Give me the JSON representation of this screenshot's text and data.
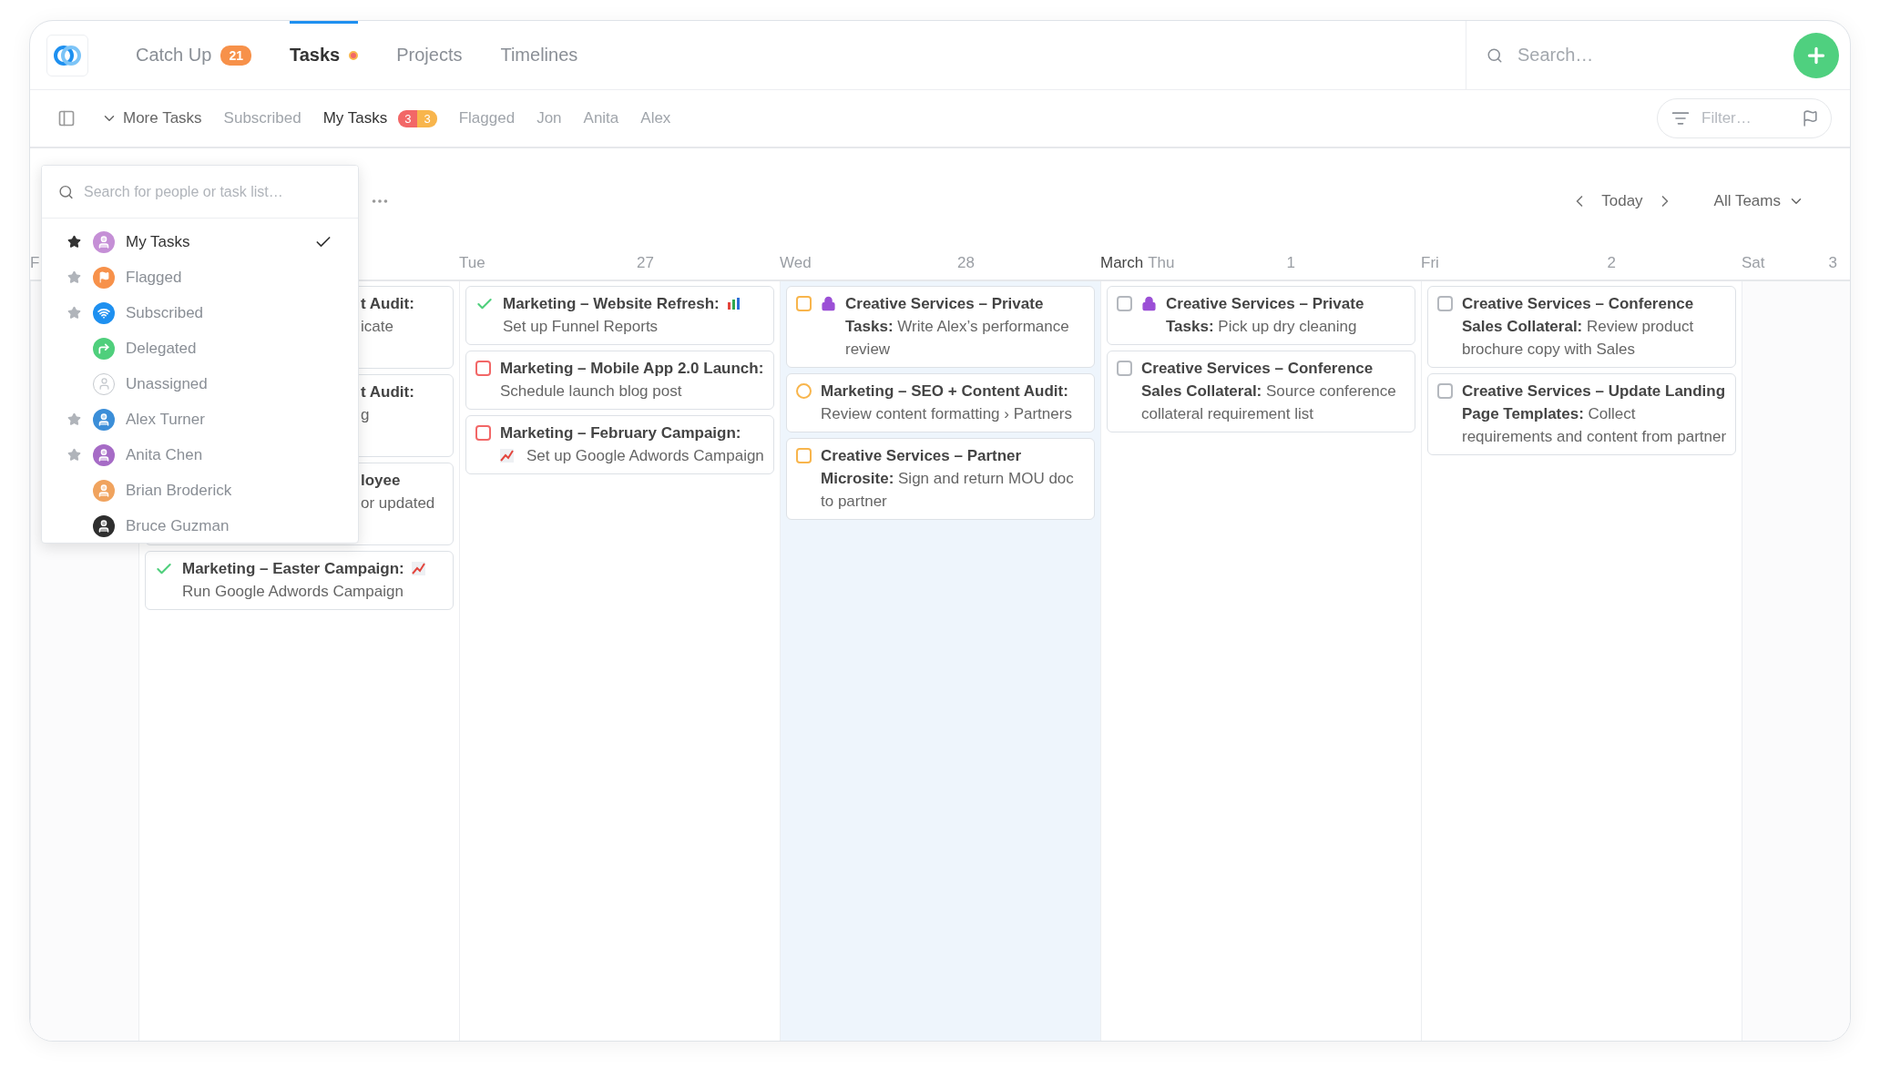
{
  "topbar": {
    "tabs": [
      {
        "label": "Catch Up",
        "badge": "21",
        "dot": false,
        "selected": false
      },
      {
        "label": "Tasks",
        "dot": true,
        "selected": true
      },
      {
        "label": "Projects",
        "dot": false,
        "selected": false
      },
      {
        "label": "Timelines",
        "dot": false,
        "selected": false
      }
    ],
    "search": {
      "placeholder": "Search…"
    }
  },
  "subnav": {
    "items": [
      {
        "label": "More Tasks",
        "kind": "menu",
        "selected": false
      },
      {
        "label": "Subscribed",
        "kind": "link",
        "selected": false
      },
      {
        "label": "My Tasks",
        "kind": "link",
        "selected": true,
        "badges": [
          {
            "text": "3",
            "color": "#f26767"
          },
          {
            "text": "3",
            "color": "#f8b54c"
          }
        ]
      },
      {
        "label": "Flagged",
        "kind": "link",
        "selected": false
      },
      {
        "label": "Jon",
        "kind": "link",
        "selected": false
      },
      {
        "label": "Anita",
        "kind": "link",
        "selected": false
      },
      {
        "label": "Alex",
        "kind": "link",
        "selected": false
      }
    ],
    "filter": {
      "placeholder": "Filter…"
    }
  },
  "calendar": {
    "nav": {
      "today": "Today",
      "team": "All Teams"
    },
    "columns": [
      {
        "kind": "narrow",
        "day": "F"
      },
      {
        "kind": "wide",
        "today": false,
        "cards": [
          {
            "title": "t Audit:",
            "body": "icate",
            "kind": "clipped"
          },
          {
            "title": "t Audit:",
            "body": "g",
            "kind": "clipped"
          },
          {
            "title": "loyee",
            "body": "or updated",
            "kind": "clipped"
          },
          {
            "title": "Marketing – Easter Campaign:",
            "title_icon": {
              "kind": "trend"
            },
            "body": "Run Google Adwords Campaign",
            "kind": "done"
          }
        ]
      },
      {
        "kind": "wide",
        "day": "Tue",
        "date": "27",
        "today": false,
        "cards": [
          {
            "title": "Marketing – Website Refresh:",
            "title_icon": {
              "kind": "bars"
            },
            "body": "Set up Funnel Reports",
            "kind": "done"
          },
          {
            "title": "Marketing – Mobile App 2.0 Launch:",
            "body": "Schedule launch blog post",
            "kind": "square",
            "color": "#f26767"
          },
          {
            "title": "Marketing – February Campaign:",
            "body_icon": {
              "kind": "trend"
            },
            "body": "Set up Google Adwords Campaign",
            "kind": "square",
            "color": "#f26767"
          }
        ]
      },
      {
        "kind": "wide",
        "day": "Wed",
        "date": "28",
        "today": true,
        "cards": [
          {
            "title": "Creative Services – Private Tasks:",
            "body": "Write Alex’s performance review",
            "kind": "square",
            "color": "#f8b54c",
            "private": true
          },
          {
            "title": "Marketing – SEO + Content Audit:",
            "body": "Review content formatting › Partners",
            "kind": "round",
            "color": "#f8b54c"
          },
          {
            "title": "Creative Services – Partner Microsite:",
            "body": "Sign and return MOU doc to partner",
            "kind": "square",
            "color": "#f8b54c"
          }
        ]
      },
      {
        "kind": "wide",
        "month": "March",
        "day": "Thu",
        "date": "1",
        "today": false,
        "cards": [
          {
            "title": "Creative Services – Private Tasks:",
            "body": "Pick up dry cleaning",
            "kind": "square",
            "color": "#b4b8be",
            "private": true
          },
          {
            "title": "Creative Services – Conference Sales Collateral:",
            "body": "Source conference collateral requirement list",
            "kind": "square",
            "color": "#b4b8be"
          }
        ]
      },
      {
        "kind": "wide",
        "day": "Fri",
        "date": "2",
        "today": false,
        "cards": [
          {
            "title": "Creative Services – Conference Sales Collateral:",
            "body": "Review product brochure copy with Sales",
            "kind": "square",
            "color": "#b4b8be"
          },
          {
            "title": "Creative Services – Update Landing Page Templates:",
            "body": "Collect requirements and content from partner",
            "kind": "square",
            "color": "#b4b8be"
          }
        ]
      },
      {
        "kind": "narrow",
        "day": "Sat",
        "date": "3"
      }
    ]
  },
  "dropdown": {
    "placeholder": "Search for people or task list…",
    "items": [
      {
        "label": "My Tasks",
        "kind": "person",
        "color": "#c58fd6",
        "starred": true,
        "selected": true
      },
      {
        "label": "Flagged",
        "kind": "flag",
        "color": "#f7914a",
        "starred": true,
        "selected": false
      },
      {
        "label": "Subscribed",
        "kind": "feed",
        "color": "#1e90f0",
        "starred": true,
        "selected": false
      },
      {
        "label": "Delegated",
        "kind": "delegate",
        "color": "#4fcf7c",
        "starred": false,
        "selected": false
      },
      {
        "label": "Unassigned",
        "kind": "unassigned",
        "starred": false,
        "selected": false
      },
      {
        "label": "Alex Turner",
        "kind": "person",
        "color": "#3b8ed8",
        "starred": true,
        "selected": false
      },
      {
        "label": "Anita Chen",
        "kind": "person",
        "color": "#a66bc6",
        "starred": true,
        "selected": false
      },
      {
        "label": "Brian Broderick",
        "kind": "person",
        "color": "#f0a35e",
        "starred": false,
        "selected": false
      },
      {
        "label": "Bruce Guzman",
        "kind": "person",
        "color": "#2e2e2e",
        "starred": false,
        "selected": false
      }
    ]
  }
}
